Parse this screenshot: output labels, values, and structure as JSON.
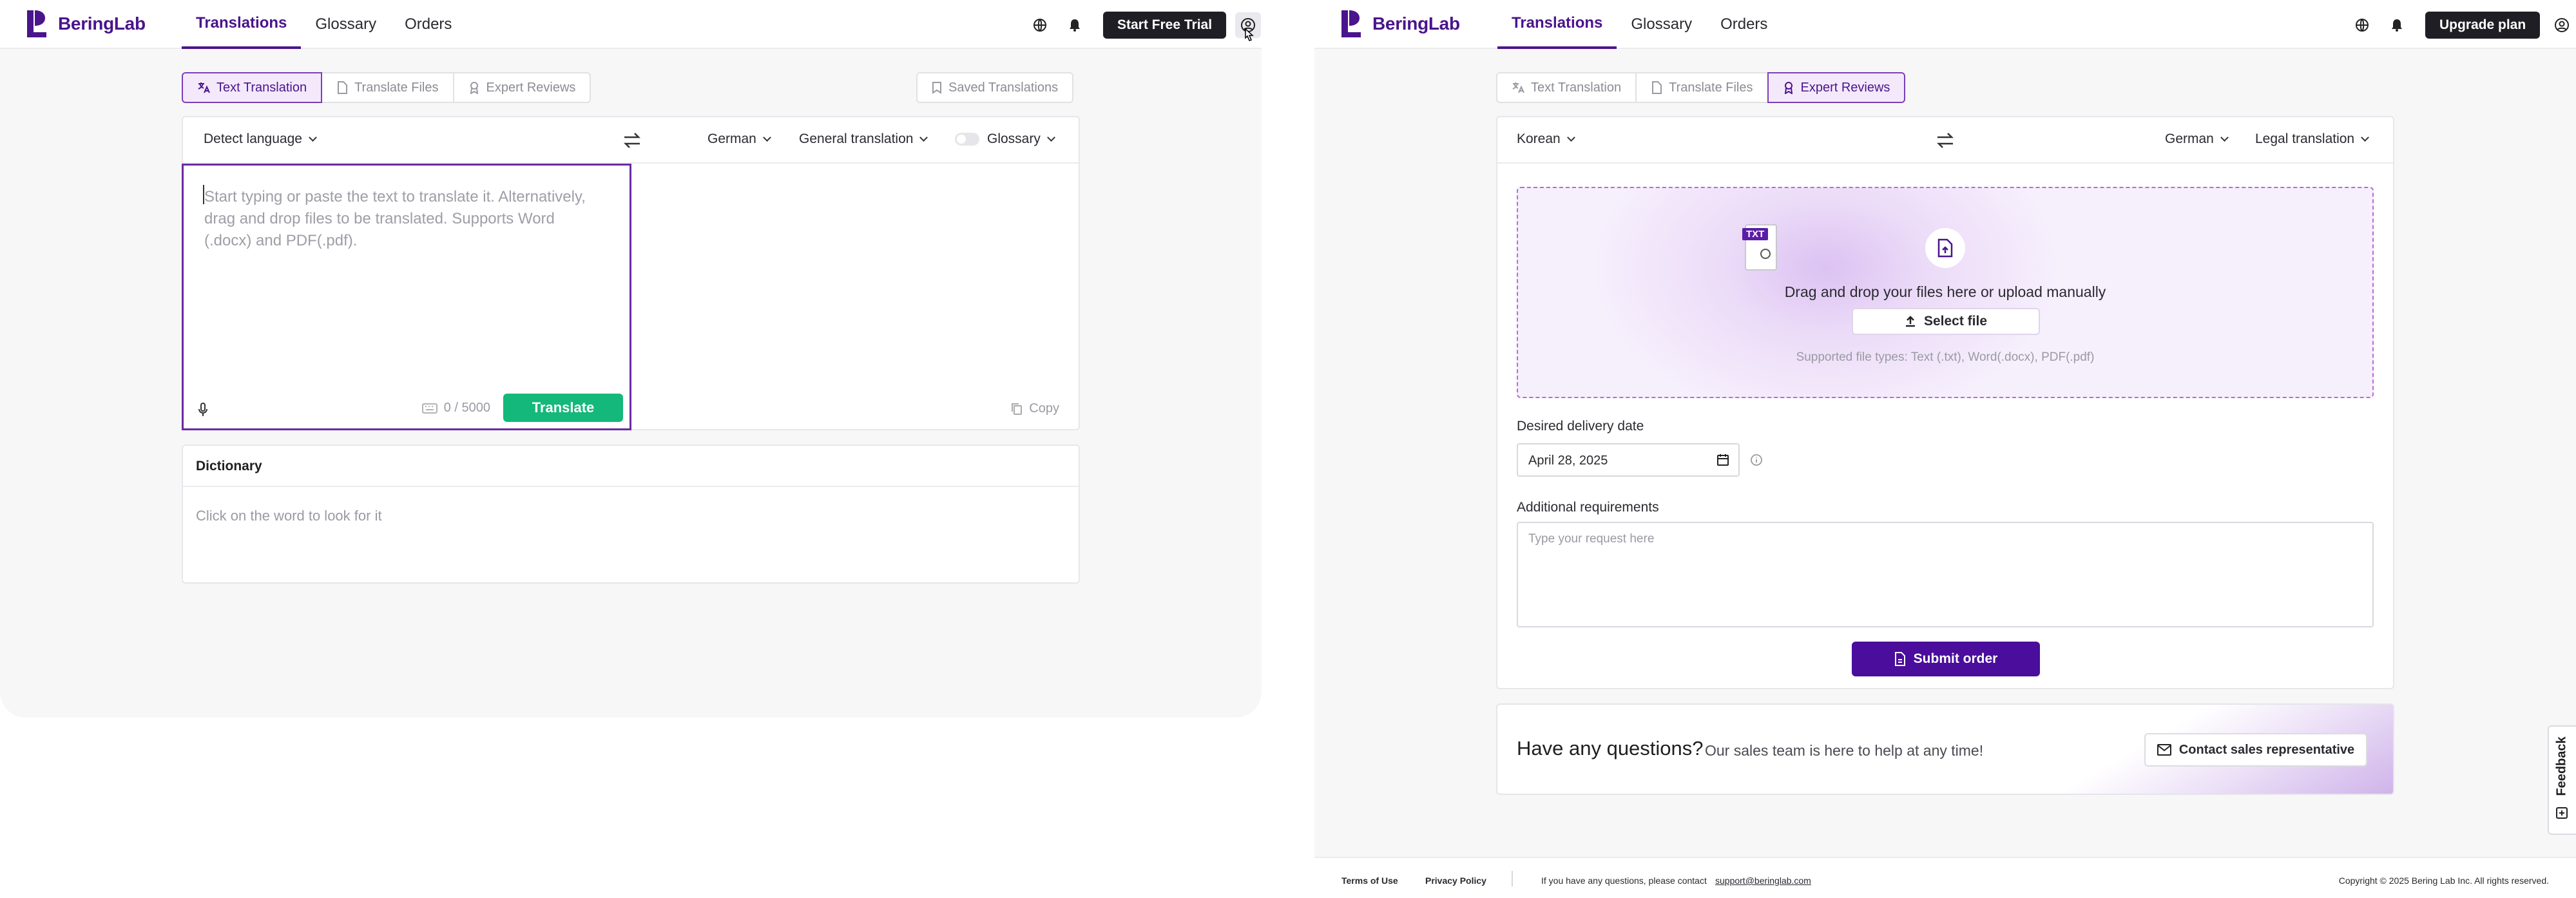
{
  "brand": {
    "name": "BeringLab",
    "color": "#4a148c"
  },
  "left": {
    "nav": [
      "Translations",
      "Glossary",
      "Orders"
    ],
    "trial_button": "Start Free Trial",
    "tabs": [
      "Text Translation",
      "Translate Files",
      "Expert Reviews"
    ],
    "saved": "Saved Translations",
    "source_lang": "Detect language",
    "target_lang": "German",
    "mode": "General translation",
    "glossary": "Glossary",
    "placeholder": "Start typing or paste the text to translate it. Alternatively, drag and drop files to be translated. Supports Word (.docx) and PDF(.pdf).",
    "counter": "0 / 5000",
    "translate": "Translate",
    "copy": "Copy",
    "dictionary_title": "Dictionary",
    "dictionary_hint": "Click on the word to look for it"
  },
  "right": {
    "nav": [
      "Translations",
      "Glossary",
      "Orders"
    ],
    "upgrade_button": "Upgrade plan",
    "tabs": [
      "Text Translation",
      "Translate Files",
      "Expert Reviews"
    ],
    "source_lang": "Korean",
    "target_lang": "German",
    "mode": "Legal translation",
    "drop_text": "Drag and drop your files here or upload manually",
    "select_file": "Select file",
    "supported": "Supported file types: Text (.txt), Word(.docx), PDF(.pdf)",
    "file_badge": "TXT",
    "delivery_label": "Desired delivery date",
    "delivery_value": "April 28, 2025",
    "requirements_label": "Additional requirements",
    "requirements_placeholder": "Type your request here",
    "submit": "Submit order",
    "questions_title": "Have any questions?",
    "questions_sub": "Our sales team is here to help at any time!",
    "contact": "Contact sales representative",
    "feedback": "Feedback",
    "footer": {
      "terms": "Terms of Use",
      "privacy": "Privacy Policy",
      "contact_text": "If you have any questions, please contact",
      "email": "support@beringlab.com",
      "copyright": "Copyright © 2025 Bering Lab Inc. All rights reserved."
    }
  },
  "colors": {
    "accent": "#4a148c",
    "green": "#14b87a",
    "submit": "#4a0d9c"
  }
}
